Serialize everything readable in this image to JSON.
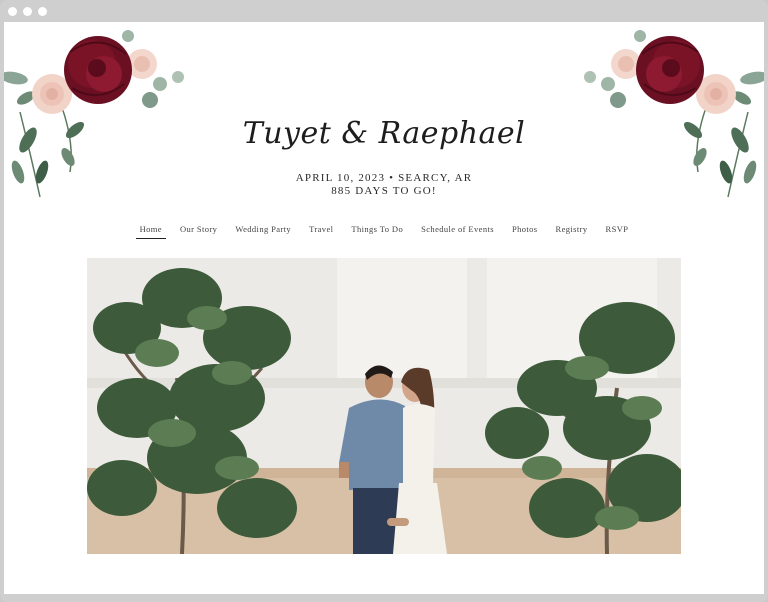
{
  "site": {
    "names": "Tuyet & Raephael",
    "date_location": "APRIL 10, 2023 • SEARCY, AR",
    "countdown": "885 DAYS TO GO!"
  },
  "nav": {
    "items": [
      {
        "label": "Home",
        "active": true
      },
      {
        "label": "Our Story"
      },
      {
        "label": "Wedding Party"
      },
      {
        "label": "Travel"
      },
      {
        "label": "Things To Do"
      },
      {
        "label": "Schedule of Events"
      },
      {
        "label": "Photos"
      },
      {
        "label": "Registry"
      },
      {
        "label": "RSVP"
      }
    ]
  },
  "colors": {
    "window_frame": "#cfcfcf",
    "page_bg": "#ffffff",
    "burgundy": "#7a1326",
    "blush": "#f1d3c8",
    "eucalyptus": "#7f9a8a"
  }
}
